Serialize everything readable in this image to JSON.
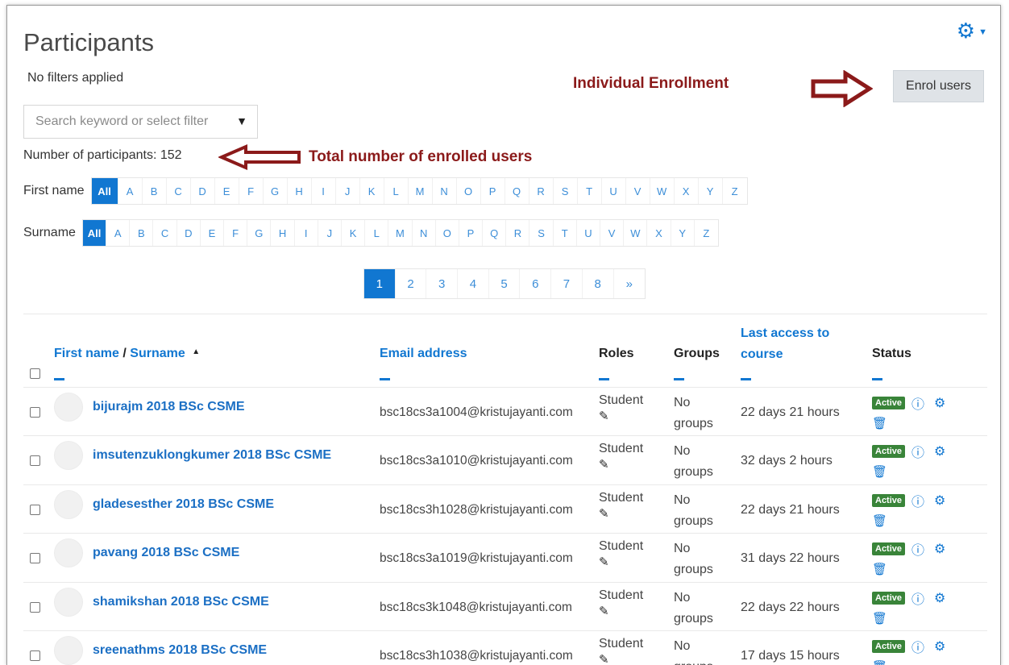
{
  "page": {
    "title": "Participants",
    "no_filters": "No filters applied",
    "enrol_button": "Enrol users",
    "search_placeholder": "Search keyword or select filter",
    "participants_count": "Number of participants: 152",
    "settings_icon": "gear-icon"
  },
  "annotations": {
    "individual_enrollment": "Individual Enrollment",
    "total_enrolled": "Total number of enrolled users",
    "arrow_color": "#8b1a1a"
  },
  "filters": {
    "first_name_label": "First name",
    "surname_label": "Surname",
    "all_label": "All",
    "letters": [
      "A",
      "B",
      "C",
      "D",
      "E",
      "F",
      "G",
      "H",
      "I",
      "J",
      "K",
      "L",
      "M",
      "N",
      "O",
      "P",
      "Q",
      "R",
      "S",
      "T",
      "U",
      "V",
      "W",
      "X",
      "Y",
      "Z"
    ]
  },
  "pagination": {
    "pages": [
      "1",
      "2",
      "3",
      "4",
      "5",
      "6",
      "7",
      "8",
      "»"
    ],
    "current": "1"
  },
  "table": {
    "headers": {
      "first_name": "First name",
      "separator": " / ",
      "surname": "Surname",
      "sort_indicator": "▲",
      "email": "Email address",
      "roles": "Roles",
      "groups": "Groups",
      "last_access": "Last access to course",
      "status": "Status"
    },
    "rows": [
      {
        "name": "bijurajm 2018 BSc CSME",
        "email": "bsc18cs3a1004@kristujayanti.com",
        "role": "Student",
        "groups_1": "No",
        "groups_2": "groups",
        "last_access": "22 days 21 hours",
        "status": "Active"
      },
      {
        "name": "imsutenzuklongkumer 2018 BSc CSME",
        "email": "bsc18cs3a1010@kristujayanti.com",
        "role": "Student",
        "groups_1": "No",
        "groups_2": "groups",
        "last_access": "32 days 2 hours",
        "status": "Active"
      },
      {
        "name": "gladesesther 2018 BSc CSME",
        "email": "bsc18cs3h1028@kristujayanti.com",
        "role": "Student",
        "groups_1": "No",
        "groups_2": "groups",
        "last_access": "22 days 21 hours",
        "status": "Active"
      },
      {
        "name": "pavang 2018 BSc CSME",
        "email": "bsc18cs3a1019@kristujayanti.com",
        "role": "Student",
        "groups_1": "No",
        "groups_2": "groups",
        "last_access": "31 days 22 hours",
        "status": "Active"
      },
      {
        "name": "shamikshan 2018 BSc CSME",
        "email": "bsc18cs3k1048@kristujayanti.com",
        "role": "Student",
        "groups_1": "No",
        "groups_2": "groups",
        "last_access": "22 days 22 hours",
        "status": "Active"
      },
      {
        "name": "sreenathms 2018 BSc CSME",
        "email": "bsc18cs3h1038@kristujayanti.com",
        "role": "Student",
        "groups_1": "No",
        "groups_2": "groups",
        "last_access": "17 days 15 hours",
        "status": "Active"
      }
    ]
  },
  "colors": {
    "accent": "#1177d1",
    "active_badge": "#398439",
    "annotation": "#8b1a1a"
  }
}
